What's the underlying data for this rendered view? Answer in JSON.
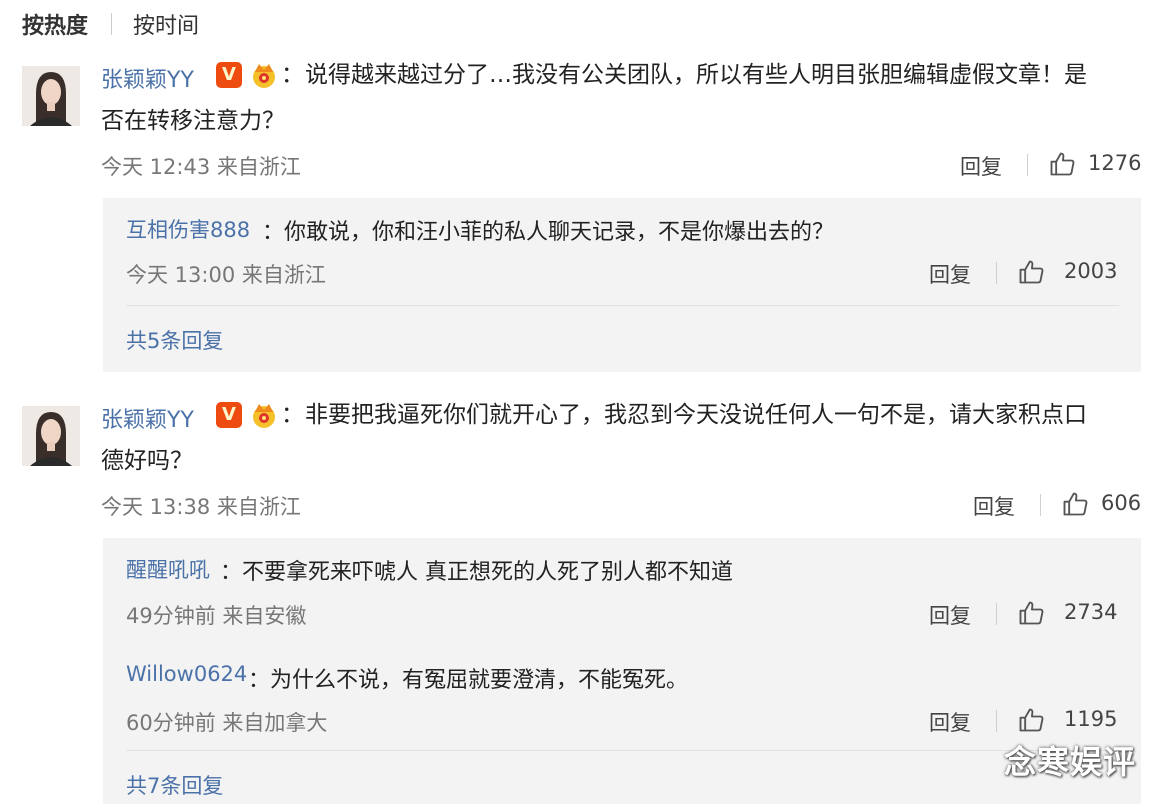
{
  "sort": {
    "active": "按热度",
    "other": "按时间"
  },
  "comments": [
    {
      "user": "张颖颖YY",
      "badge": "V",
      "colon": "：",
      "line1": "说得越来越过分了…我没有公关团队，所以有些人明目张胆编辑虚假文章！是",
      "line2": "否在转移注意力？",
      "time": "今天 12:43 来自浙江",
      "reply_label": "回复",
      "likes": "1276",
      "replies": [
        {
          "user": "互相伤害888",
          "text": "：你敢说，你和汪小菲的私人聊天记录，不是你爆出去的？",
          "time": "今天 13:00 来自浙江",
          "reply_label": "回复",
          "likes": "2003"
        }
      ],
      "more": "共5条回复"
    },
    {
      "user": "张颖颖YY",
      "badge": "V",
      "colon": "：",
      "line1": "非要把我逼死你们就开心了，我忍到今天没说任何人一句不是，请大家积点口",
      "line2": "德好吗？",
      "time": "今天 13:38 来自浙江",
      "reply_label": "回复",
      "likes": "606",
      "replies": [
        {
          "user": "醒醒吼吼",
          "text": "：不要拿死来吓唬人 真正想死的人死了别人都不知道",
          "time": "49分钟前 来自安徽",
          "reply_label": "回复",
          "likes": "2734"
        },
        {
          "user": "Willow0624",
          "text": "：为什么不说，有冤屈就要澄清，不能冤死。",
          "time": "60分钟前 来自加拿大",
          "reply_label": "回复",
          "likes": "1195"
        }
      ],
      "more": "共7条回复"
    }
  ],
  "watermark": "念寒娱评",
  "colors": {
    "link": "#4b72a8",
    "badge": "#ee4b10",
    "reply_bg": "#f3f3f3"
  }
}
